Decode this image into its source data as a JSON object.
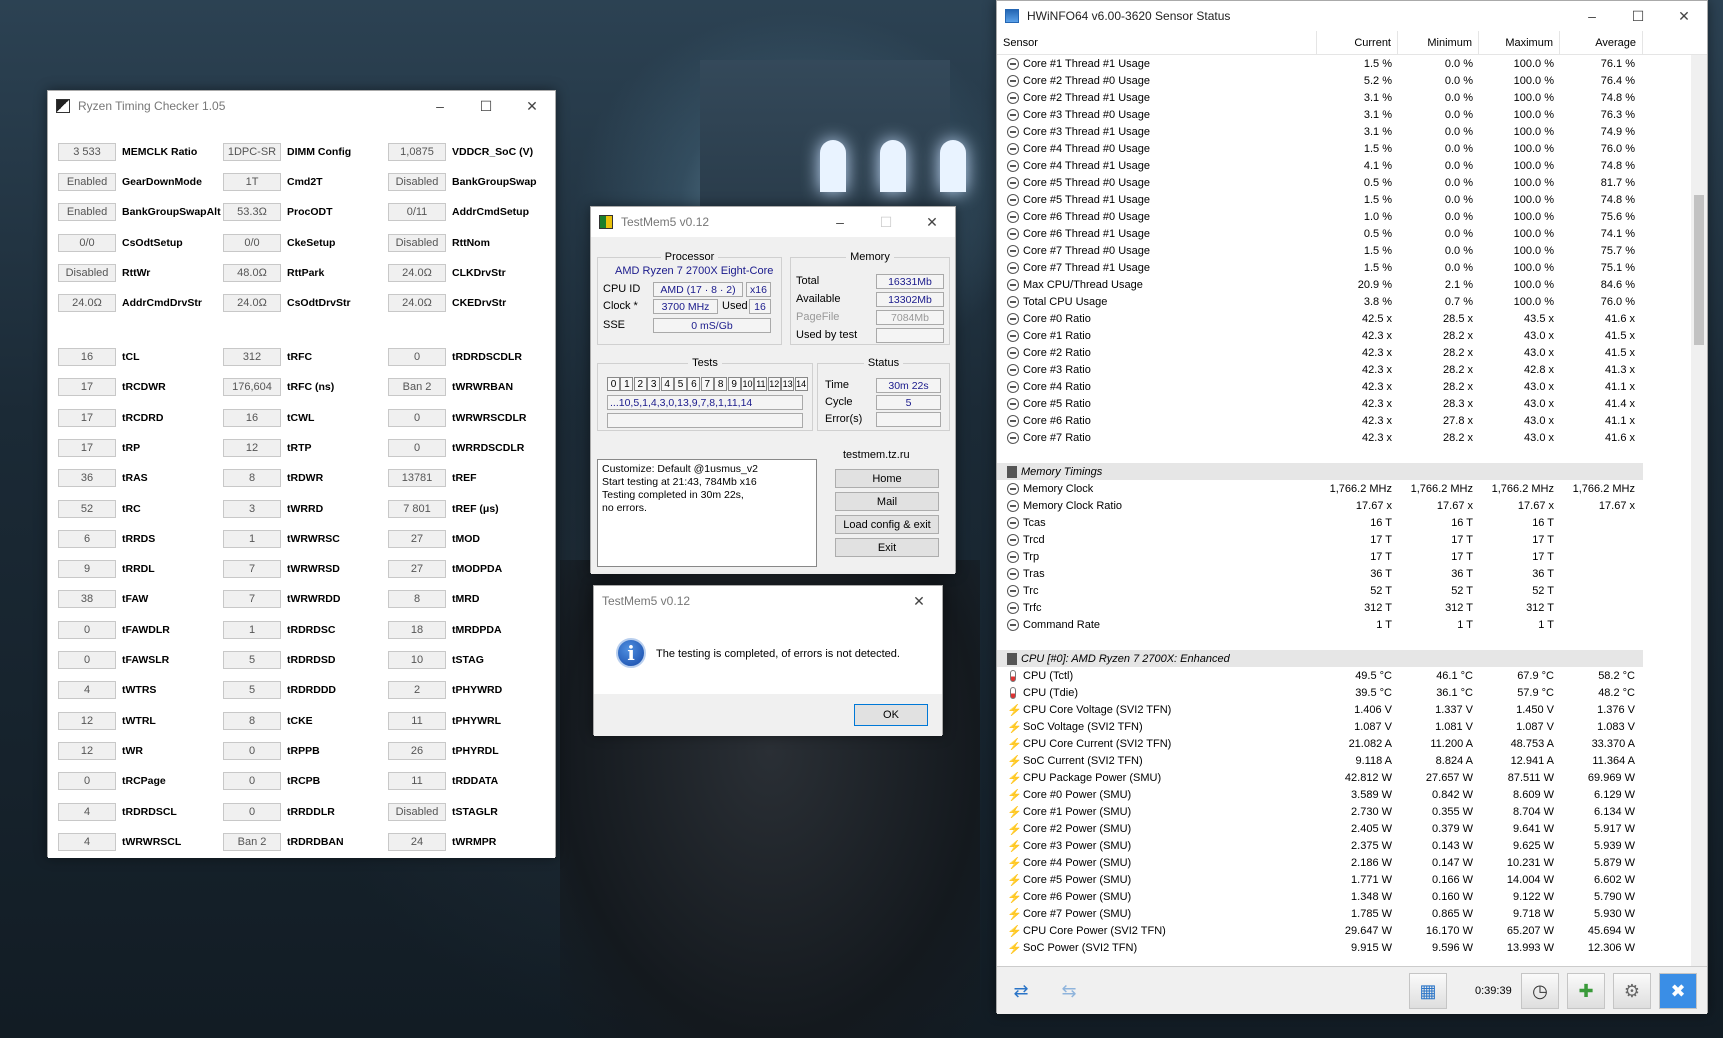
{
  "rtc": {
    "title": "Ryzen Timing Checker 1.05",
    "col1": [
      {
        "v": "3 533",
        "l": "MEMCLK Ratio"
      },
      {
        "v": "Enabled",
        "l": "GearDownMode"
      },
      {
        "v": "Enabled",
        "l": "BankGroupSwapAlt"
      },
      {
        "v": "0/0",
        "l": "CsOdtSetup"
      },
      {
        "v": "Disabled",
        "l": "RttWr"
      },
      {
        "v": "24.0Ω",
        "l": "AddrCmdDrvStr"
      },
      {
        "v": "16",
        "l": "tCL"
      },
      {
        "v": "17",
        "l": "tRCDWR"
      },
      {
        "v": "17",
        "l": "tRCDRD"
      },
      {
        "v": "17",
        "l": "tRP"
      },
      {
        "v": "36",
        "l": "tRAS"
      },
      {
        "v": "52",
        "l": "tRC"
      },
      {
        "v": "6",
        "l": "tRRDS"
      },
      {
        "v": "9",
        "l": "tRRDL"
      },
      {
        "v": "38",
        "l": "tFAW"
      },
      {
        "v": "0",
        "l": "tFAWDLR"
      },
      {
        "v": "0",
        "l": "tFAWSLR"
      },
      {
        "v": "4",
        "l": "tWTRS"
      },
      {
        "v": "12",
        "l": "tWTRL"
      },
      {
        "v": "12",
        "l": "tWR"
      },
      {
        "v": "0",
        "l": "tRCPage"
      },
      {
        "v": "4",
        "l": "tRDRDSCL"
      },
      {
        "v": "4",
        "l": "tWRWRSCL"
      }
    ],
    "col2": [
      {
        "v": "1DPC-SR",
        "l": "DIMM Config"
      },
      {
        "v": "1T",
        "l": "Cmd2T"
      },
      {
        "v": "53.3Ω",
        "l": "ProcODT"
      },
      {
        "v": "0/0",
        "l": "CkeSetup"
      },
      {
        "v": "48.0Ω",
        "l": "RttPark"
      },
      {
        "v": "24.0Ω",
        "l": "CsOdtDrvStr"
      },
      {
        "v": "312",
        "l": "tRFC"
      },
      {
        "v": "176,604",
        "l": "tRFC (ns)"
      },
      {
        "v": "16",
        "l": "tCWL"
      },
      {
        "v": "12",
        "l": "tRTP"
      },
      {
        "v": "8",
        "l": "tRDWR"
      },
      {
        "v": "3",
        "l": "tWRRD"
      },
      {
        "v": "1",
        "l": "tWRWRSC"
      },
      {
        "v": "7",
        "l": "tWRWRSD"
      },
      {
        "v": "7",
        "l": "tWRWRDD"
      },
      {
        "v": "1",
        "l": "tRDRDSC"
      },
      {
        "v": "5",
        "l": "tRDRDSD"
      },
      {
        "v": "5",
        "l": "tRDRDDD"
      },
      {
        "v": "8",
        "l": "tCKE"
      },
      {
        "v": "0",
        "l": "tRPPB"
      },
      {
        "v": "0",
        "l": "tRCPB"
      },
      {
        "v": "0",
        "l": "tRRDDLR"
      },
      {
        "v": "Ban 2",
        "l": "tRDRDBAN"
      }
    ],
    "col3": [
      {
        "v": "1,0875",
        "l": "VDDCR_SoC (V)"
      },
      {
        "v": "Disabled",
        "l": "BankGroupSwap"
      },
      {
        "v": "0/11",
        "l": "AddrCmdSetup"
      },
      {
        "v": "Disabled",
        "l": "RttNom"
      },
      {
        "v": "24.0Ω",
        "l": "CLKDrvStr"
      },
      {
        "v": "24.0Ω",
        "l": "CKEDrvStr"
      },
      {
        "v": "0",
        "l": "tRDRDSCDLR"
      },
      {
        "v": "Ban 2",
        "l": "tWRWRBAN"
      },
      {
        "v": "0",
        "l": "tWRWRSCDLR"
      },
      {
        "v": "0",
        "l": "tWRRDSCDLR"
      },
      {
        "v": "13781",
        "l": "tREF"
      },
      {
        "v": "7 801",
        "l": "tREF (μs)"
      },
      {
        "v": "27",
        "l": "tMOD"
      },
      {
        "v": "27",
        "l": "tMODPDA"
      },
      {
        "v": "8",
        "l": "tMRD"
      },
      {
        "v": "18",
        "l": "tMRDPDA"
      },
      {
        "v": "10",
        "l": "tSTAG"
      },
      {
        "v": "2",
        "l": "tPHYWRD"
      },
      {
        "v": "11",
        "l": "tPHYWRL"
      },
      {
        "v": "26",
        "l": "tPHYRDL"
      },
      {
        "v": "11",
        "l": "tRDDATA"
      },
      {
        "v": "Disabled",
        "l": "tSTAGLR"
      },
      {
        "v": "24",
        "l": "tWRMPR"
      }
    ]
  },
  "testmem": {
    "title": "TestMem5 v0.12",
    "processor_label": "Processor",
    "cpu_name": "AMD Ryzen 7 2700X Eight-Core",
    "cpu_id_label": "CPU ID",
    "cpu_id": "AMD  (17 · 8 · 2)",
    "threads": "x16",
    "clock_label": "Clock *",
    "clock": "3700 MHz",
    "used_label": "Used",
    "used": "16",
    "sse_label": "SSE",
    "sse": "0 mS/Gb",
    "memory_label": "Memory",
    "total_label": "Total",
    "total": "16331Mb",
    "available_label": "Available",
    "available": "13302Mb",
    "pagefile_label": "PageFile",
    "pagefile": "7084Mb",
    "usedbytest_label": "Used by test",
    "tests_label": "Tests",
    "test_numbers": [
      "0",
      "1",
      "2",
      "3",
      "4",
      "5",
      "6",
      "7",
      "8",
      "9",
      "10",
      "11",
      "12",
      "13",
      "14"
    ],
    "test_sequence": "...10,5,1,4,3,0,13,9,7,8,1,11,14",
    "status_label": "Status",
    "time_label": "Time",
    "time": "30m 22s",
    "cycle_label": "Cycle",
    "cycle": "5",
    "errors_label": "Error(s)",
    "log": "Customize: Default @1usmus_v2\nStart testing at 21:43, 784Mb x16\nTesting completed in 30m 22s,\nno errors.",
    "site": "testmem.tz.ru",
    "btn_home": "Home",
    "btn_mail": "Mail",
    "btn_load": "Load config & exit",
    "btn_exit": "Exit"
  },
  "dialog": {
    "title": "TestMem5 v0.12",
    "message": "The testing is completed, of errors is not detected.",
    "ok": "OK"
  },
  "hwinfo": {
    "title": "HWiNFO64 v6.00-3620 Sensor Status",
    "headers": [
      "Sensor",
      "Current",
      "Minimum",
      "Maximum",
      "Average"
    ],
    "uptime": "0:39:39",
    "rows": [
      {
        "i": "clock",
        "n": "Core #1 Thread #1 Usage",
        "c": "1.5 %",
        "mi": "0.0 %",
        "ma": "100.0 %",
        "a": "76.1 %"
      },
      {
        "i": "clock",
        "n": "Core #2 Thread #0 Usage",
        "c": "5.2 %",
        "mi": "0.0 %",
        "ma": "100.0 %",
        "a": "76.4 %"
      },
      {
        "i": "clock",
        "n": "Core #2 Thread #1 Usage",
        "c": "3.1 %",
        "mi": "0.0 %",
        "ma": "100.0 %",
        "a": "74.8 %"
      },
      {
        "i": "clock",
        "n": "Core #3 Thread #0 Usage",
        "c": "3.1 %",
        "mi": "0.0 %",
        "ma": "100.0 %",
        "a": "76.3 %"
      },
      {
        "i": "clock",
        "n": "Core #3 Thread #1 Usage",
        "c": "3.1 %",
        "mi": "0.0 %",
        "ma": "100.0 %",
        "a": "74.9 %"
      },
      {
        "i": "clock",
        "n": "Core #4 Thread #0 Usage",
        "c": "1.5 %",
        "mi": "0.0 %",
        "ma": "100.0 %",
        "a": "76.0 %"
      },
      {
        "i": "clock",
        "n": "Core #4 Thread #1 Usage",
        "c": "4.1 %",
        "mi": "0.0 %",
        "ma": "100.0 %",
        "a": "74.8 %"
      },
      {
        "i": "clock",
        "n": "Core #5 Thread #0 Usage",
        "c": "0.5 %",
        "mi": "0.0 %",
        "ma": "100.0 %",
        "a": "81.7 %"
      },
      {
        "i": "clock",
        "n": "Core #5 Thread #1 Usage",
        "c": "1.5 %",
        "mi": "0.0 %",
        "ma": "100.0 %",
        "a": "74.8 %"
      },
      {
        "i": "clock",
        "n": "Core #6 Thread #0 Usage",
        "c": "1.0 %",
        "mi": "0.0 %",
        "ma": "100.0 %",
        "a": "75.6 %"
      },
      {
        "i": "clock",
        "n": "Core #6 Thread #1 Usage",
        "c": "0.5 %",
        "mi": "0.0 %",
        "ma": "100.0 %",
        "a": "74.1 %"
      },
      {
        "i": "clock",
        "n": "Core #7 Thread #0 Usage",
        "c": "1.5 %",
        "mi": "0.0 %",
        "ma": "100.0 %",
        "a": "75.7 %"
      },
      {
        "i": "clock",
        "n": "Core #7 Thread #1 Usage",
        "c": "1.5 %",
        "mi": "0.0 %",
        "ma": "100.0 %",
        "a": "75.1 %"
      },
      {
        "i": "clock",
        "n": "Max CPU/Thread Usage",
        "c": "20.9 %",
        "mi": "2.1 %",
        "ma": "100.0 %",
        "a": "84.6 %"
      },
      {
        "i": "clock",
        "n": "Total CPU Usage",
        "c": "3.8 %",
        "mi": "0.7 %",
        "ma": "100.0 %",
        "a": "76.0 %"
      },
      {
        "i": "clock",
        "n": "Core #0 Ratio",
        "c": "42.5 x",
        "mi": "28.5 x",
        "ma": "43.5 x",
        "a": "41.6 x"
      },
      {
        "i": "clock",
        "n": "Core #1 Ratio",
        "c": "42.3 x",
        "mi": "28.2 x",
        "ma": "43.0 x",
        "a": "41.5 x"
      },
      {
        "i": "clock",
        "n": "Core #2 Ratio",
        "c": "42.3 x",
        "mi": "28.2 x",
        "ma": "43.0 x",
        "a": "41.5 x"
      },
      {
        "i": "clock",
        "n": "Core #3 Ratio",
        "c": "42.3 x",
        "mi": "28.2 x",
        "ma": "42.8 x",
        "a": "41.3 x"
      },
      {
        "i": "clock",
        "n": "Core #4 Ratio",
        "c": "42.3 x",
        "mi": "28.2 x",
        "ma": "43.0 x",
        "a": "41.1 x"
      },
      {
        "i": "clock",
        "n": "Core #5 Ratio",
        "c": "42.3 x",
        "mi": "28.3 x",
        "ma": "43.0 x",
        "a": "41.4 x"
      },
      {
        "i": "clock",
        "n": "Core #6 Ratio",
        "c": "42.3 x",
        "mi": "27.8 x",
        "ma": "43.0 x",
        "a": "41.1 x"
      },
      {
        "i": "clock",
        "n": "Core #7 Ratio",
        "c": "42.3 x",
        "mi": "28.2 x",
        "ma": "43.0 x",
        "a": "41.6 x"
      },
      {
        "i": "blank",
        "n": "",
        "c": "",
        "mi": "",
        "ma": "",
        "a": ""
      },
      {
        "i": "chip",
        "n": "Memory Timings",
        "c": "",
        "mi": "",
        "ma": "",
        "a": "",
        "g": true
      },
      {
        "i": "clock",
        "n": "Memory Clock",
        "c": "1,766.2 MHz",
        "mi": "1,766.2 MHz",
        "ma": "1,766.2 MHz",
        "a": "1,766.2 MHz"
      },
      {
        "i": "clock",
        "n": "Memory Clock Ratio",
        "c": "17.67 x",
        "mi": "17.67 x",
        "ma": "17.67 x",
        "a": "17.67 x"
      },
      {
        "i": "clock",
        "n": "Tcas",
        "c": "16 T",
        "mi": "16 T",
        "ma": "16 T",
        "a": ""
      },
      {
        "i": "clock",
        "n": "Trcd",
        "c": "17 T",
        "mi": "17 T",
        "ma": "17 T",
        "a": ""
      },
      {
        "i": "clock",
        "n": "Trp",
        "c": "17 T",
        "mi": "17 T",
        "ma": "17 T",
        "a": ""
      },
      {
        "i": "clock",
        "n": "Tras",
        "c": "36 T",
        "mi": "36 T",
        "ma": "36 T",
        "a": ""
      },
      {
        "i": "clock",
        "n": "Trc",
        "c": "52 T",
        "mi": "52 T",
        "ma": "52 T",
        "a": ""
      },
      {
        "i": "clock",
        "n": "Trfc",
        "c": "312 T",
        "mi": "312 T",
        "ma": "312 T",
        "a": ""
      },
      {
        "i": "clock",
        "n": "Command Rate",
        "c": "1 T",
        "mi": "1 T",
        "ma": "1 T",
        "a": ""
      },
      {
        "i": "blank",
        "n": "",
        "c": "",
        "mi": "",
        "ma": "",
        "a": ""
      },
      {
        "i": "chip",
        "n": "CPU [#0]: AMD Ryzen 7 2700X: Enhanced",
        "c": "",
        "mi": "",
        "ma": "",
        "a": "",
        "g": true
      },
      {
        "i": "therm",
        "n": "CPU (Tctl)",
        "c": "49.5 °C",
        "mi": "46.1 °C",
        "ma": "67.9 °C",
        "a": "58.2 °C"
      },
      {
        "i": "therm",
        "n": "CPU (Tdie)",
        "c": "39.5 °C",
        "mi": "36.1 °C",
        "ma": "57.9 °C",
        "a": "48.2 °C"
      },
      {
        "i": "bolt",
        "n": "CPU Core Voltage (SVI2 TFN)",
        "c": "1.406 V",
        "mi": "1.337 V",
        "ma": "1.450 V",
        "a": "1.376 V"
      },
      {
        "i": "bolt",
        "n": "SoC Voltage (SVI2 TFN)",
        "c": "1.087 V",
        "mi": "1.081 V",
        "ma": "1.087 V",
        "a": "1.083 V"
      },
      {
        "i": "bolt",
        "n": "CPU Core Current (SVI2 TFN)",
        "c": "21.082 A",
        "mi": "11.200 A",
        "ma": "48.753 A",
        "a": "33.370 A"
      },
      {
        "i": "bolt",
        "n": "SoC Current (SVI2 TFN)",
        "c": "9.118 A",
        "mi": "8.824 A",
        "ma": "12.941 A",
        "a": "11.364 A"
      },
      {
        "i": "bolt",
        "n": "CPU Package Power (SMU)",
        "c": "42.812 W",
        "mi": "27.657 W",
        "ma": "87.511 W",
        "a": "69.969 W"
      },
      {
        "i": "bolt",
        "n": "Core #0 Power (SMU)",
        "c": "3.589 W",
        "mi": "0.842 W",
        "ma": "8.609 W",
        "a": "6.129 W"
      },
      {
        "i": "bolt",
        "n": "Core #1 Power (SMU)",
        "c": "2.730 W",
        "mi": "0.355 W",
        "ma": "8.704 W",
        "a": "6.134 W"
      },
      {
        "i": "bolt",
        "n": "Core #2 Power (SMU)",
        "c": "2.405 W",
        "mi": "0.379 W",
        "ma": "9.641 W",
        "a": "5.917 W"
      },
      {
        "i": "bolt",
        "n": "Core #3 Power (SMU)",
        "c": "2.375 W",
        "mi": "0.143 W",
        "ma": "9.625 W",
        "a": "5.939 W"
      },
      {
        "i": "bolt",
        "n": "Core #4 Power (SMU)",
        "c": "2.186 W",
        "mi": "0.147 W",
        "ma": "10.231 W",
        "a": "5.879 W"
      },
      {
        "i": "bolt",
        "n": "Core #5 Power (SMU)",
        "c": "1.771 W",
        "mi": "0.166 W",
        "ma": "14.004 W",
        "a": "6.602 W"
      },
      {
        "i": "bolt",
        "n": "Core #6 Power (SMU)",
        "c": "1.348 W",
        "mi": "0.160 W",
        "ma": "9.122 W",
        "a": "5.790 W"
      },
      {
        "i": "bolt",
        "n": "Core #7 Power (SMU)",
        "c": "1.785 W",
        "mi": "0.865 W",
        "ma": "9.718 W",
        "a": "5.930 W"
      },
      {
        "i": "bolt",
        "n": "CPU Core Power (SVI2 TFN)",
        "c": "29.647 W",
        "mi": "16.170 W",
        "ma": "65.207 W",
        "a": "45.694 W"
      },
      {
        "i": "bolt",
        "n": "SoC Power (SVI2 TFN)",
        "c": "9.915 W",
        "mi": "9.596 W",
        "ma": "13.993 W",
        "a": "12.306 W"
      }
    ]
  }
}
